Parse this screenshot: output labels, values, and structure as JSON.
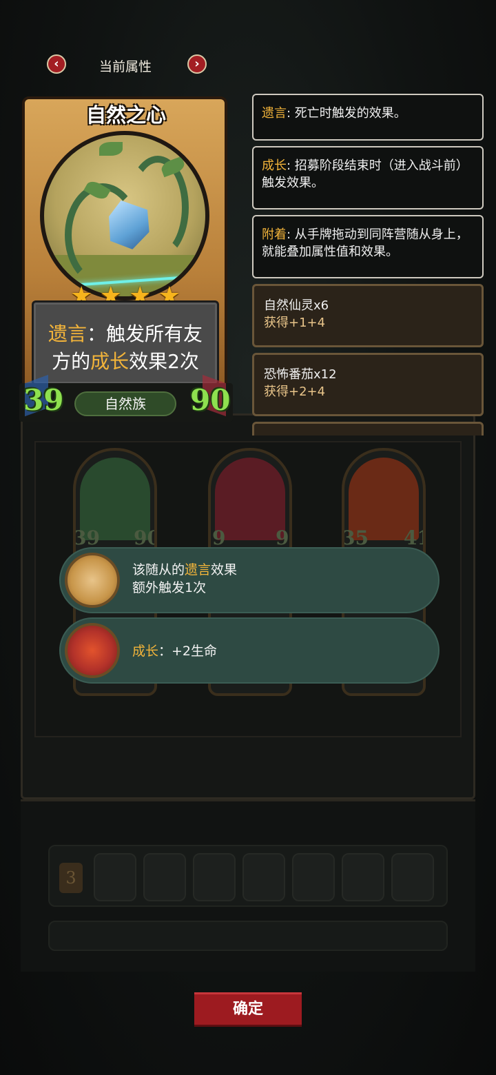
{
  "header": {
    "title": "当前属性",
    "prev_icon": "‹",
    "next_icon": "›"
  },
  "card": {
    "name": "自然之心",
    "stars": 4,
    "text_parts": [
      "遗言",
      "：触发所有友方的",
      "成长",
      "效果2次"
    ],
    "attack": "39",
    "health": "90",
    "tribe": "自然族"
  },
  "glossary": [
    {
      "keyword": "遗言",
      "text": ": 死亡时触发的效果。"
    },
    {
      "keyword": "成长",
      "text": ": 招募阶段结束时（进入战斗前）触发效果。"
    },
    {
      "keyword": "附着",
      "text": ": 从手牌拖动到同阵营随从身上，就能叠加属性值和效果。"
    }
  ],
  "resources": [
    {
      "name": "自然仙灵x6",
      "gain": "获得+1+4"
    },
    {
      "name": "恐怖番茄x12",
      "gain": "获得+2+4"
    }
  ],
  "board_minions": [
    {
      "atk": "39",
      "hp": "90",
      "art_color": "#294a2e"
    },
    {
      "atk": "9",
      "hp": "9",
      "art_color": "#5a1c24"
    },
    {
      "atk": "35",
      "hp": "41",
      "art_color": "#6a2a16"
    }
  ],
  "hand_badge": "3",
  "panels": [
    {
      "line1_prefix": "该随从的",
      "keyword": "遗言",
      "line1_suffix": "效果",
      "line2": "额外触发1次",
      "icon": "skull-badge-icon"
    },
    {
      "keyword": "成长",
      "text": "：+2生命",
      "icon": "red-skull-badge-icon"
    }
  ],
  "confirm_label": "确定",
  "colors": {
    "keyword": "#f3b43a",
    "stat": "#8ee04f",
    "confirm": "#9d1b20",
    "panel": "#2e4a43"
  }
}
